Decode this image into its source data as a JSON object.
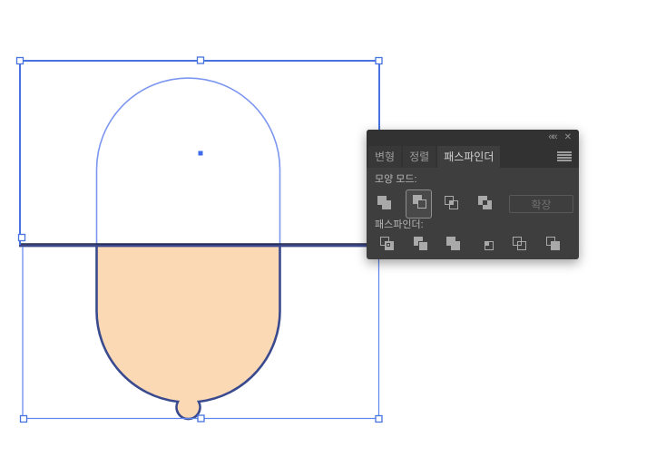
{
  "app": "illustrator-canvas",
  "canvas": {
    "artboard_background": "#ffffff",
    "shape": {
      "name": "bell-shape",
      "fill": "#fbd9b4",
      "stroke": "#3a4a8f"
    },
    "hidden_path_outline_color": "#7d97f0",
    "selection": {
      "bbox_stroke": "#4673e0",
      "thin_bbox_stroke": "#5f85ee",
      "rect_bottom_edge_dark": "#3b478d",
      "rect_bottom_edge_darker": "#141a36",
      "handle_fill": "#ffffff",
      "center_marker_color": "#3f6be8"
    }
  },
  "panel": {
    "window_controls": {
      "collapse_label": "««",
      "close_label": "✕"
    },
    "tabs": [
      {
        "label": "변형"
      },
      {
        "label": "정렬"
      },
      {
        "label": "패스파인더"
      }
    ],
    "active_tab": "패스파인더",
    "shape_modes": {
      "label": "모양 모드:",
      "buttons": [
        "unite",
        "minus-front",
        "intersect",
        "exclude"
      ],
      "selected": "minus-front",
      "expand_label": "확장",
      "expand_disabled": true
    },
    "pathfinders": {
      "label": "패스파인더:",
      "buttons": [
        "divide",
        "trim",
        "merge",
        "crop",
        "outline",
        "minus-back"
      ]
    }
  }
}
